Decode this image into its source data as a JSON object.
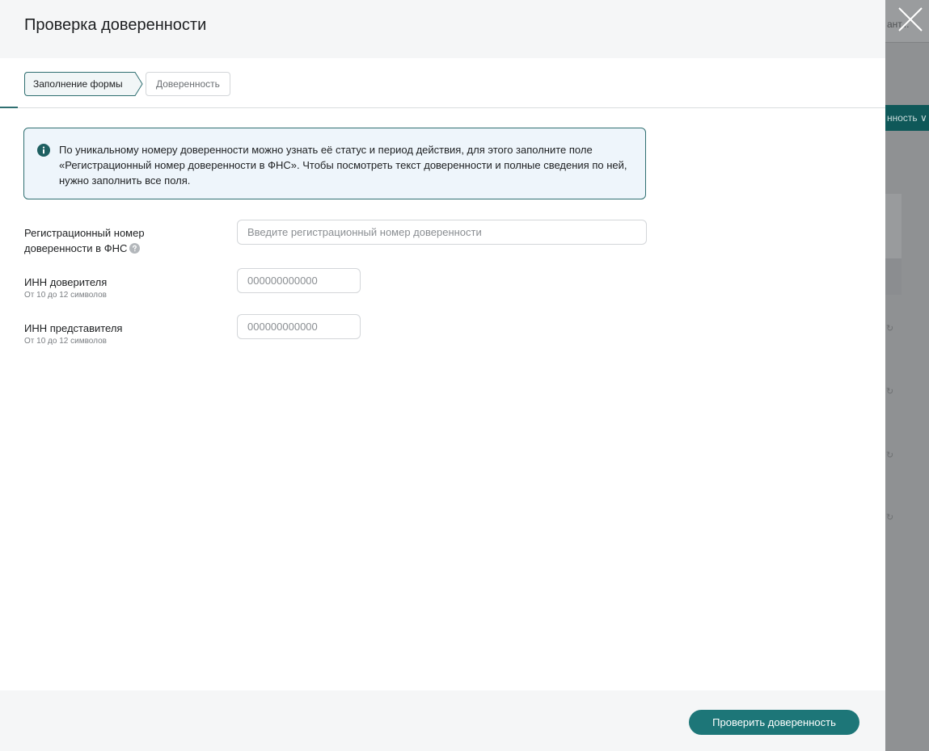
{
  "modal": {
    "title": "Проверка доверенности"
  },
  "steps": [
    {
      "label": "Заполнение формы"
    },
    {
      "label": "Доверенность"
    }
  ],
  "info": {
    "text": "По уникальному номеру доверенности можно узнать её статус и период действия, для этого заполните поле «Регистрационный номер доверенности в ФНС». Чтобы посмотреть текст доверенности и полные сведения по ней, нужно заполнить все поля."
  },
  "fields": {
    "reg_number": {
      "label_line1": "Регистрационный номер",
      "label_line2": "доверенности в ФНС",
      "placeholder": "Введите регистрационный номер доверенности",
      "value": ""
    },
    "principal_inn": {
      "label": "ИНН доверителя",
      "hint": "От 10 до 12 символов",
      "placeholder": "000000000000",
      "value": ""
    },
    "representative_inn": {
      "label": "ИНН представителя",
      "hint": "От 10 до 12 символов",
      "placeholder": "000000000000",
      "value": ""
    }
  },
  "footer": {
    "submit_label": "Проверить доверенность"
  },
  "background": {
    "user_label": "ант...",
    "dropdown_label": "нность ∨"
  },
  "icons": {
    "info": "info-circle-icon",
    "help": "question-circle-icon",
    "close": "close-icon"
  },
  "colors": {
    "accent": "#1d7678",
    "info_bg": "#eef5fb",
    "info_border": "#2f6f71"
  }
}
